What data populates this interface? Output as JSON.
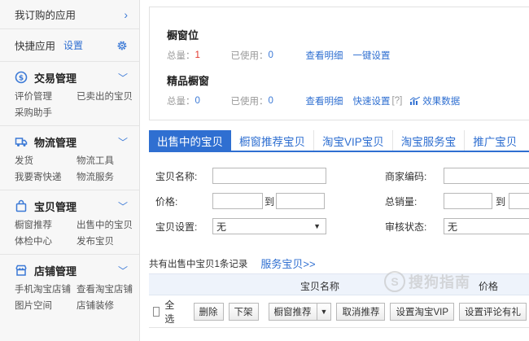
{
  "sidebar": {
    "subscribed": {
      "label": "我订购的应用"
    },
    "quick": {
      "label": "快捷应用",
      "settings": "设置"
    },
    "sections": [
      {
        "title": "交易管理",
        "links": [
          "评价管理",
          "已卖出的宝贝",
          "采购助手"
        ]
      },
      {
        "title": "物流管理",
        "links": [
          "发货",
          "物流工具",
          "我要寄快递",
          "物流服务"
        ]
      },
      {
        "title": "宝贝管理",
        "links": [
          "橱窗推荐",
          "出售中的宝贝",
          "体检中心",
          "发布宝贝"
        ]
      },
      {
        "title": "店铺管理",
        "links": [
          "手机淘宝店铺",
          "查看淘宝店铺",
          "图片空间",
          "店铺装修"
        ]
      }
    ]
  },
  "showcase": {
    "window": {
      "title": "橱窗位",
      "total_label": "总量：",
      "total_value": "1",
      "used_label": "已使用：",
      "used_value": "0",
      "details_link": "查看明细",
      "setup_link": "一键设置"
    },
    "premium": {
      "title": "精品橱窗",
      "total_label": "总量：",
      "total_value": "0",
      "used_label": "已使用：",
      "used_value": "0",
      "details_link": "查看明细",
      "quick_setup_link": "快速设置",
      "help": "[?]",
      "effect_link": "效果数据"
    }
  },
  "tabs": [
    "出售中的宝贝",
    "橱窗推荐宝贝",
    "淘宝VIP宝贝",
    "淘宝服务宝",
    "推广宝贝"
  ],
  "filters": {
    "item_name_label": "宝贝名称:",
    "merchant_code_label": "商家编码:",
    "price_label": "价格:",
    "to_label": "到",
    "total_sales_label": "总销量:",
    "to_label_2": "到",
    "item_setting_label": "宝贝设置:",
    "item_setting_value": "无",
    "review_status_label": "审核状态:",
    "review_status_value": "无"
  },
  "records": {
    "summary": "共有出售中宝贝1条记录",
    "service_link": "服务宝贝>>"
  },
  "table": {
    "col_name": "宝贝名称",
    "col_price": "价格"
  },
  "actions": {
    "select_all": "全选",
    "delete": "删除",
    "delist": "下架",
    "window_recommend": "橱窗推荐",
    "cancel_recommend": "取消推荐",
    "set_vip": "设置淘宝VIP",
    "set_review": "设置评论有礼"
  },
  "watermark": {
    "glyph": "S",
    "text": "搜狗指南"
  },
  "colors": {
    "accent": "#2f6fd1",
    "red_value": "#e2372c",
    "sidebar_bg": "#f7f7f7"
  }
}
